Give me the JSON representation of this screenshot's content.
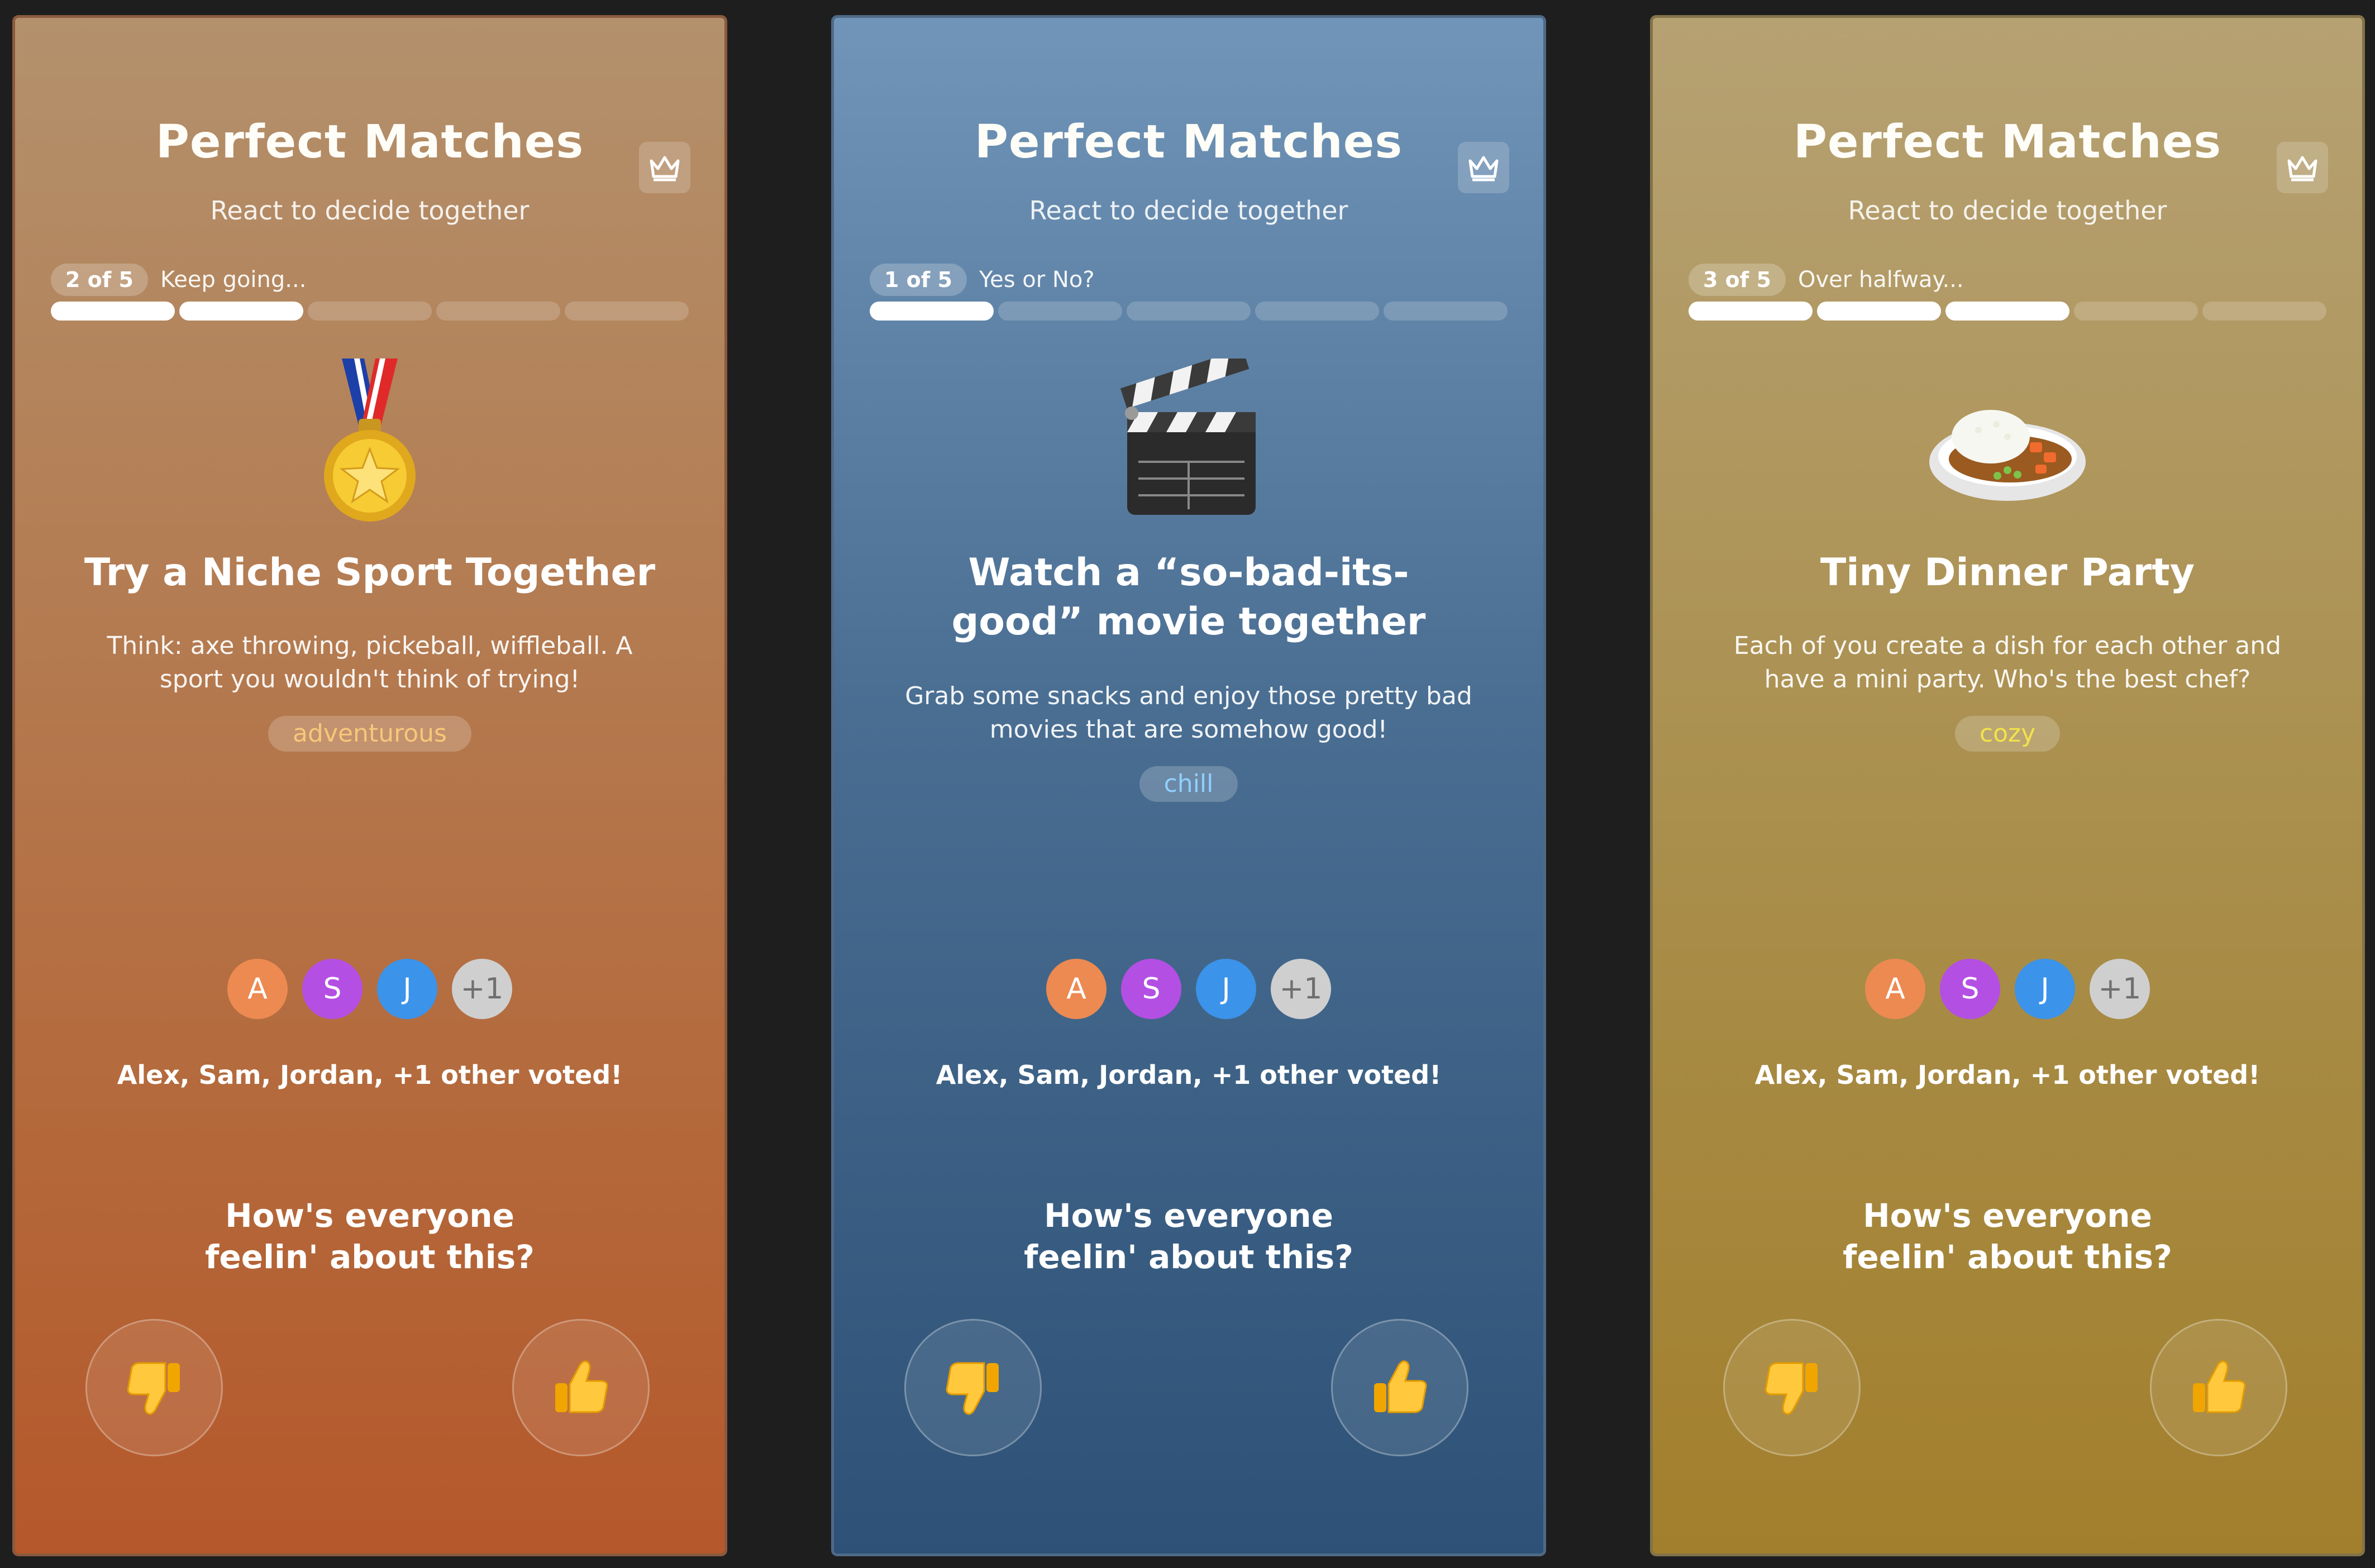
{
  "cards": [
    {
      "title": "Perfect Matches",
      "subtitle": "React to decide together",
      "step_label": "2 of 5",
      "step_text": "Keep going...",
      "progress": {
        "filled": 2,
        "total": 5
      },
      "emoji": "medal-icon",
      "heading": "Try a Niche Sport Together",
      "description": "Think: axe throwing, pickeball, wiffleball. A sport you wouldn't think of trying!",
      "tag": "adventurous",
      "tag_color": "#f7c77a",
      "voters": [
        "A",
        "S",
        "J",
        "+1"
      ],
      "voted_text": "Alex, Sam, Jordan, +1 other voted!",
      "question_line1": "How's everyone",
      "question_line2": "feelin' about this?"
    },
    {
      "title": "Perfect Matches",
      "subtitle": "React to decide together",
      "step_label": "1 of 5",
      "step_text": "Yes or No?",
      "progress": {
        "filled": 1,
        "total": 5
      },
      "emoji": "clapperboard-icon",
      "heading": "Watch a “so-bad-its-good” movie together",
      "description": "Grab some snacks and enjoy those pretty bad movies that are somehow good!",
      "tag": "chill",
      "tag_color": "#8fd0ff",
      "voters": [
        "A",
        "S",
        "J",
        "+1"
      ],
      "voted_text": "Alex, Sam, Jordan, +1 other voted!",
      "question_line1": "How's everyone",
      "question_line2": "feelin' about this?"
    },
    {
      "title": "Perfect Matches",
      "subtitle": "React to decide together",
      "step_label": "3 of 5",
      "step_text": "Over halfway...",
      "progress": {
        "filled": 3,
        "total": 5
      },
      "emoji": "curry-rice-icon",
      "heading": "Tiny Dinner Party",
      "description": "Each of you create a dish for each other and have a mini party. Who's the best chef?",
      "tag": "cozy",
      "tag_color": "#f3e24a",
      "voters": [
        "A",
        "S",
        "J",
        "+1"
      ],
      "voted_text": "Alex, Sam, Jordan, +1 other voted!",
      "question_line1": "How's everyone",
      "question_line2": "feelin' about this?"
    }
  ],
  "avatar_colors": [
    "#ec8a52",
    "#b44fe3",
    "#3b93ea",
    "#cfcfcf"
  ]
}
